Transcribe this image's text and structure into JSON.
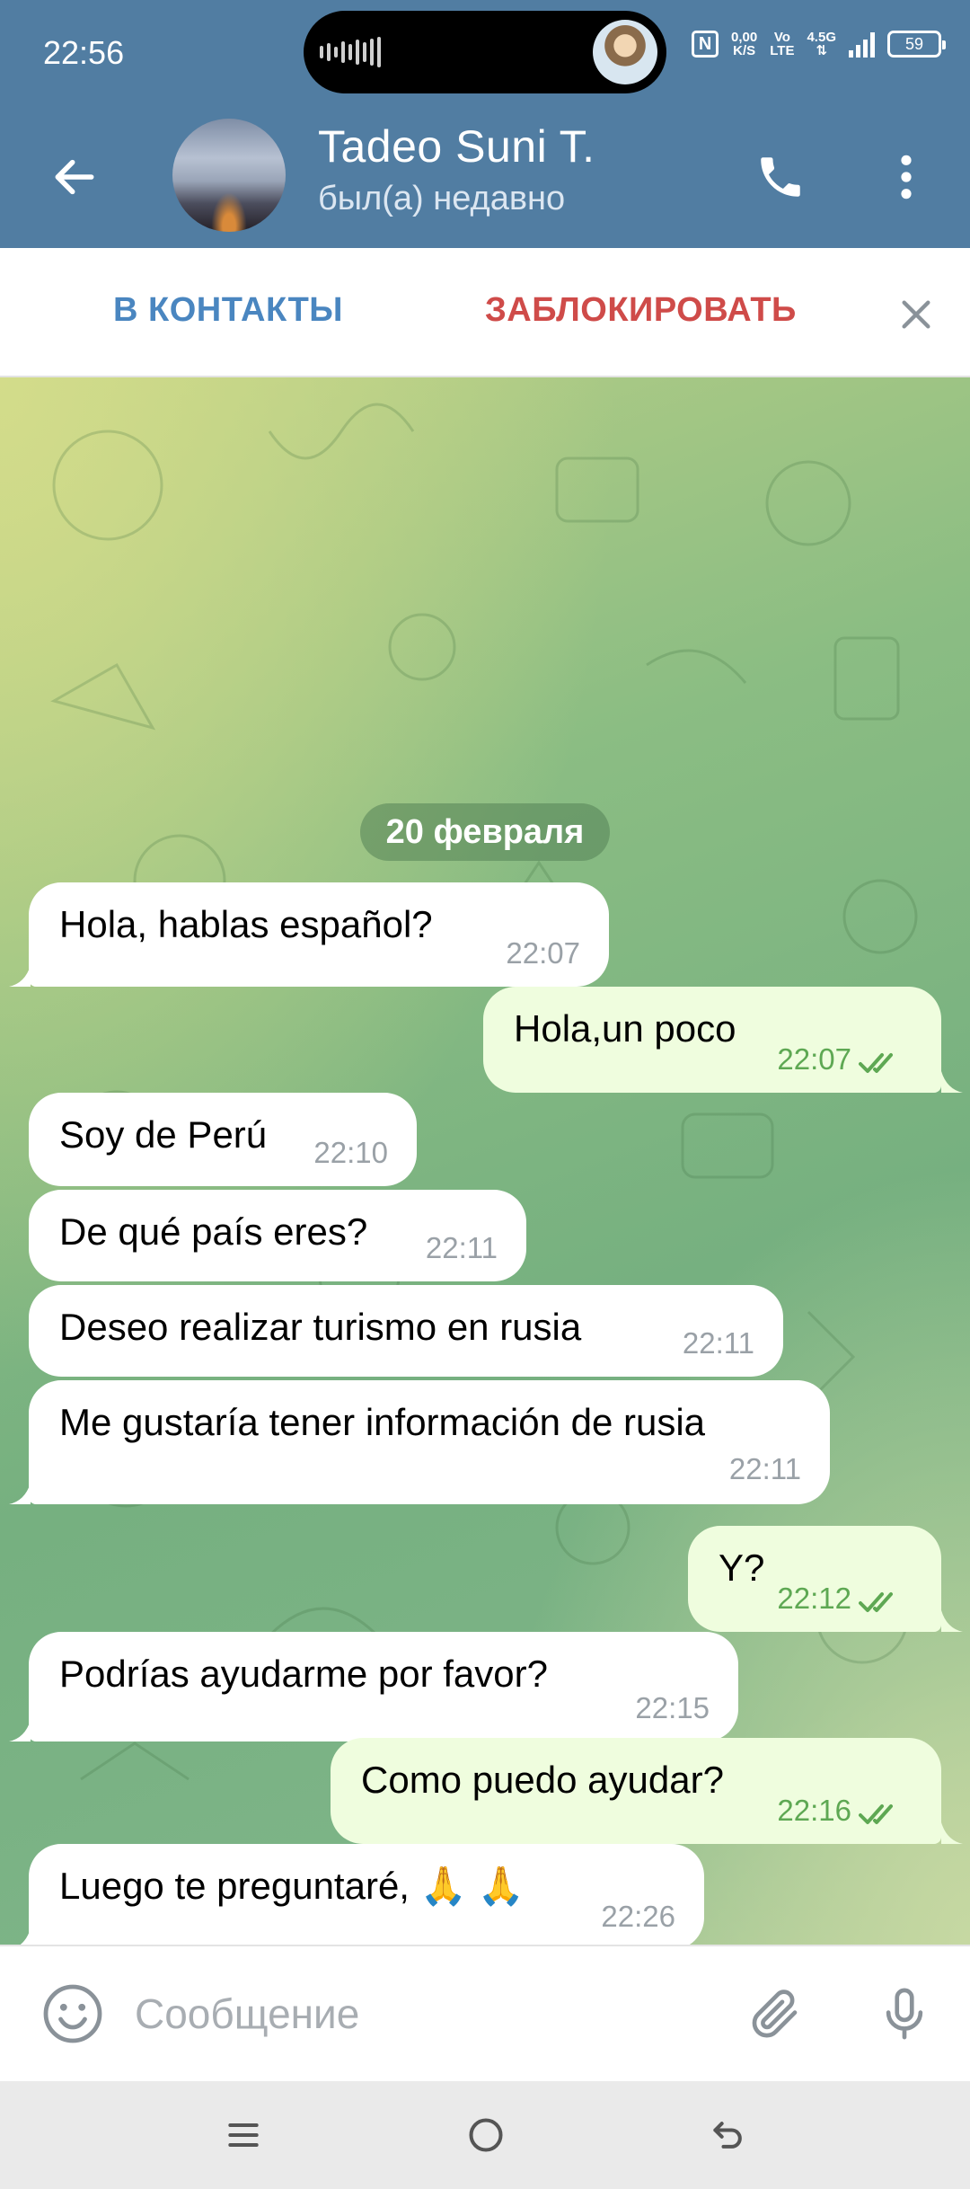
{
  "status_bar": {
    "time": "22:56",
    "net_speed_value": "0,00",
    "net_speed_unit": "K/S",
    "volte_top": "Vo",
    "volte_bottom": "LTE",
    "network": "4.5G",
    "battery": "59"
  },
  "header": {
    "contact_name": "Tadeo Suni T.",
    "last_seen": "был(а) недавно"
  },
  "action_bar": {
    "add_contact_label": "В КОНТАКТЫ",
    "block_label": "ЗАБЛОКИРОВАТЬ"
  },
  "chat": {
    "date_separator": "20 февраля",
    "messages": [
      {
        "direction": "in",
        "text": "Hola, hablas español?",
        "time": "22:07"
      },
      {
        "direction": "out",
        "text": "Hola,un poco",
        "time": "22:07",
        "read": true
      },
      {
        "direction": "in",
        "text": "Soy de Perú",
        "time": "22:10"
      },
      {
        "direction": "in",
        "text": "De qué país eres?",
        "time": "22:11"
      },
      {
        "direction": "in",
        "text": "Deseo realizar turismo en rusia",
        "time": "22:11"
      },
      {
        "direction": "in",
        "text": "Me gustaría tener información de rusia",
        "time": "22:11"
      },
      {
        "direction": "out",
        "text": "Y?",
        "time": "22:12",
        "read": true
      },
      {
        "direction": "in",
        "text": "Podrías ayudarme por favor?",
        "time": "22:15"
      },
      {
        "direction": "out",
        "text": "Como puedo ayudar?",
        "time": "22:16",
        "read": true
      },
      {
        "direction": "in",
        "text": "Luego te preguntaré, 🙏 🙏",
        "time": "22:26"
      }
    ]
  },
  "composer": {
    "placeholder": "Сообщение"
  },
  "colors": {
    "header_bg": "#517da2",
    "add_contact": "#4a86c0",
    "block": "#cf4b49",
    "out_bubble": "#effdde",
    "read_check": "#5ea853"
  },
  "icons": {
    "back": "arrow-left-icon",
    "call": "phone-icon",
    "menu": "more-vertical-icon",
    "close": "close-icon",
    "emoji": "smile-icon",
    "attach": "paperclip-icon",
    "mic": "microphone-icon"
  }
}
